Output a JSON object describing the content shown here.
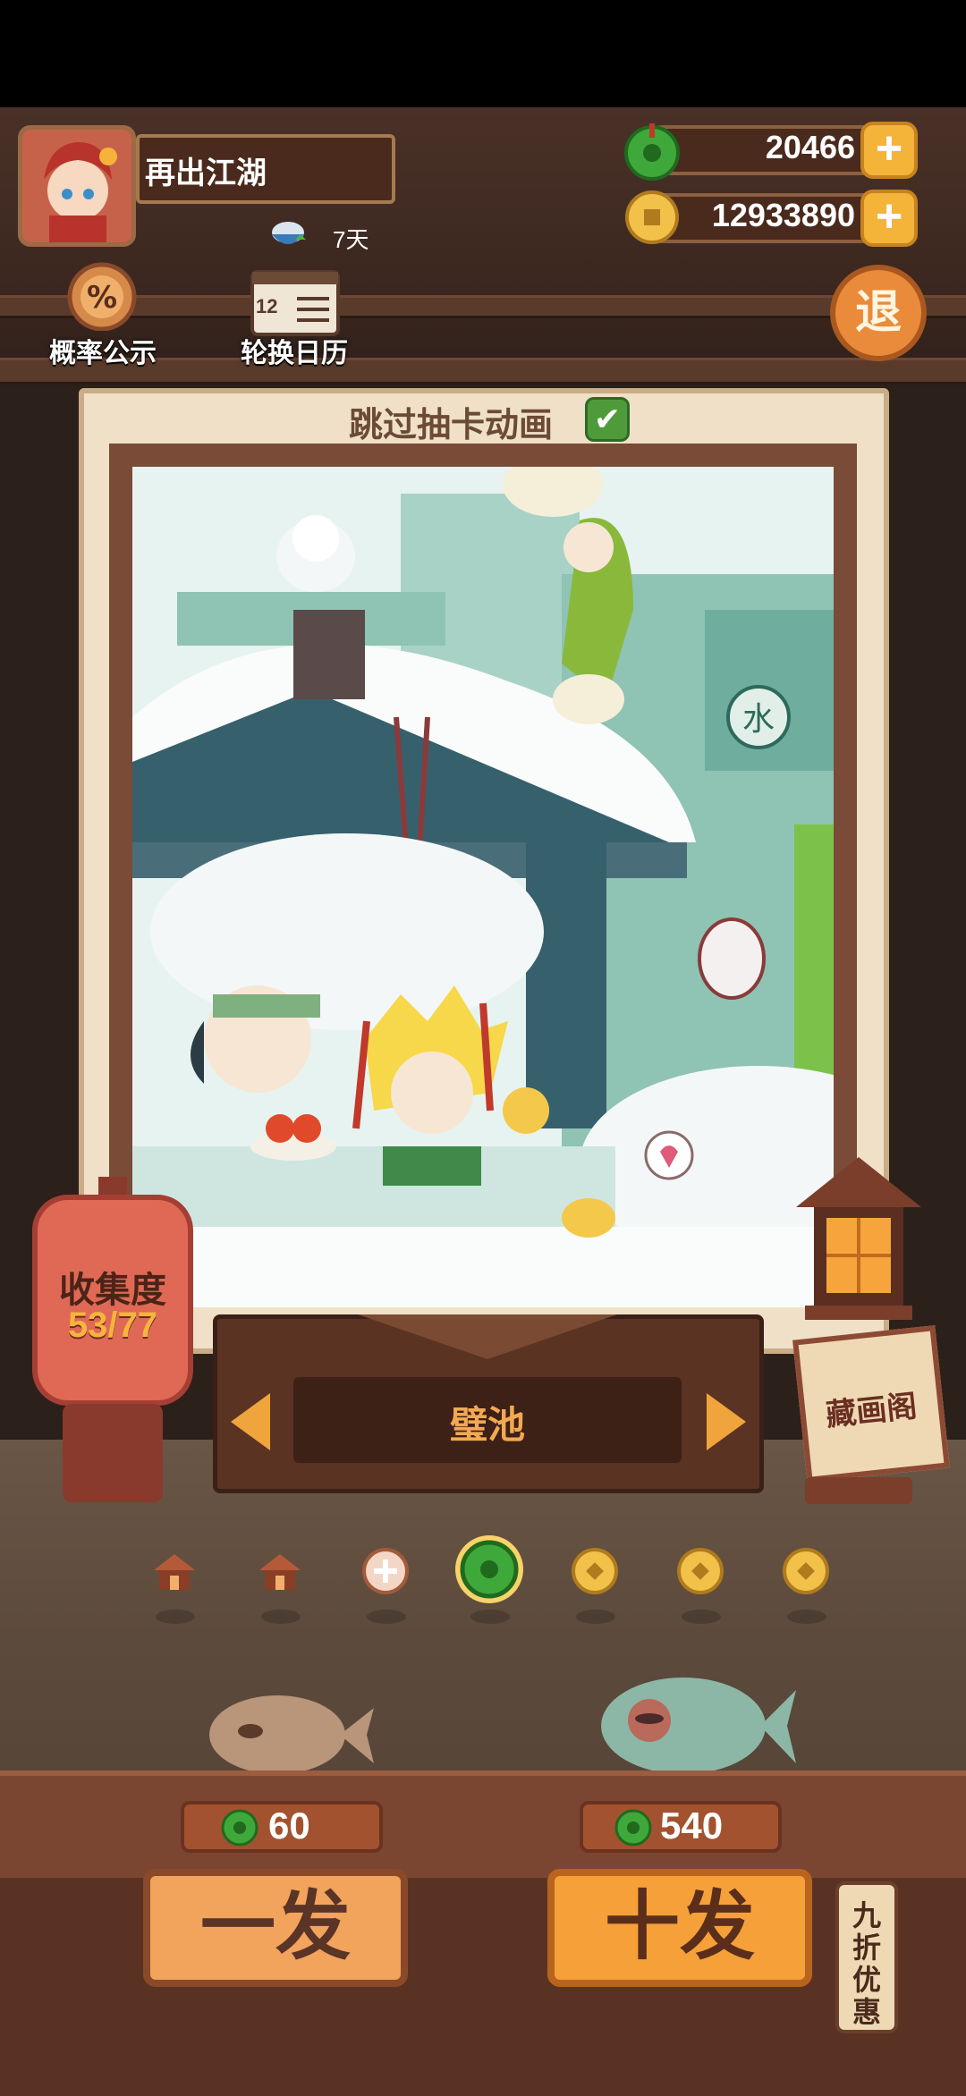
{
  "player": {
    "name": "再出江湖",
    "days": "7天"
  },
  "currency": {
    "jade": "20466",
    "coins": "12933890"
  },
  "top_buttons": {
    "probability": "概率公示",
    "rotation": "轮换日历",
    "retreat": "退",
    "calendar_number": "12"
  },
  "card": {
    "skip_animation": "跳过抽卡动画",
    "skip_checked": true,
    "artwork_sign": "水"
  },
  "collection": {
    "label": "收集度",
    "value": "53/77"
  },
  "artwork": {
    "name": "璧池"
  },
  "pavilion": {
    "label": "藏画阁"
  },
  "page_dots": {
    "icons": [
      "house-icon",
      "house-icon",
      "plus-badge-icon",
      "jade-icon",
      "coin-icon",
      "coin-icon",
      "coin-icon"
    ],
    "active_index": 3
  },
  "draw": {
    "single_label": "一发",
    "single_price": "60",
    "ten_label": "十发",
    "ten_price": "540",
    "discount": "九折优惠"
  },
  "colors": {
    "accent": "#f2a35c",
    "jade": "#3fa83a",
    "wood": "#5a3224"
  }
}
